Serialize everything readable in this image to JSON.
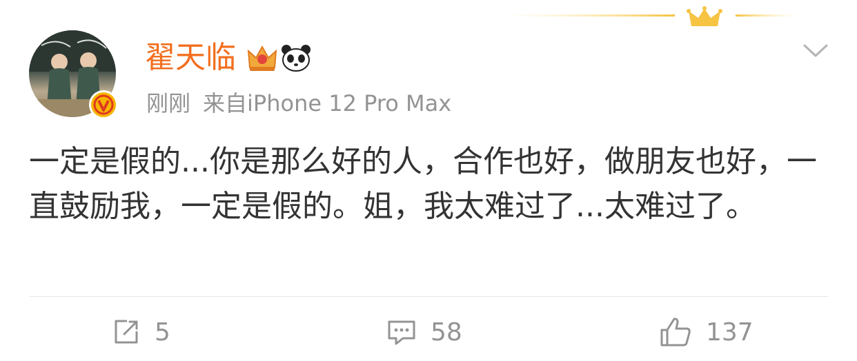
{
  "colors": {
    "username": "#f26f1f",
    "meta": "#939393",
    "body": "#333333",
    "verified": "#f7b500",
    "divider": "#e8e8e8"
  },
  "post": {
    "author": {
      "name": "翟天临",
      "avatar": "avatar-photo",
      "verified_icon": "verified-v-icon",
      "badges": [
        "crown-badge-icon",
        "panda-badge-icon"
      ]
    },
    "time": "刚刚",
    "source": "来自iPhone 12 Pro Max",
    "text": "一定是假的...你是那么好的人，合作也好，做朋友也好，一直鼓励我，一定是假的。姐，我太难过了...太难过了。"
  },
  "actions": {
    "repost": {
      "icon": "repost-icon",
      "count": "5"
    },
    "comment": {
      "icon": "comment-icon",
      "count": "58"
    },
    "like": {
      "icon": "like-icon",
      "count": "137"
    }
  }
}
